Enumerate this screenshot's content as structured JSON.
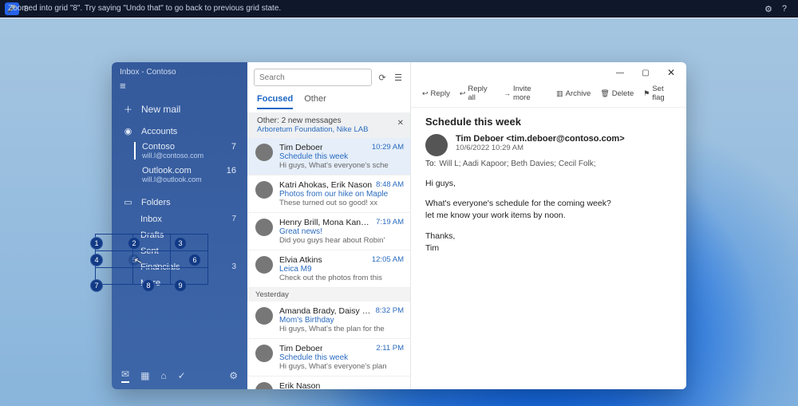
{
  "voicebar": {
    "indicator": "8",
    "message": "Zoomed into grid \"8\". Try saying \"Undo that\" to go back to previous grid state."
  },
  "sidebar": {
    "title": "Inbox - Contoso",
    "newmail": "New mail",
    "accounts_label": "Accounts",
    "accounts": [
      {
        "name": "Contoso",
        "email": "will.l@contoso.com",
        "count": "7"
      },
      {
        "name": "Outlook.com",
        "email": "will.l@outlook.com",
        "count": "16"
      }
    ],
    "folders_label": "Folders",
    "folders": [
      {
        "name": "Inbox",
        "count": "7"
      },
      {
        "name": "Drafts",
        "count": ""
      },
      {
        "name": "Sent",
        "count": ""
      },
      {
        "name": "Financials",
        "count": "3",
        "expandable": true
      },
      {
        "name": "More",
        "count": ""
      }
    ]
  },
  "list": {
    "search_placeholder": "Search",
    "tabs": {
      "focused": "Focused",
      "other": "Other"
    },
    "otherbar": {
      "line1": "Other: 2 new messages",
      "line2": "Arboretum Foundation, Nike LAB"
    },
    "items": [
      {
        "from": "Tim Deboer",
        "subject": "Schedule this week",
        "preview": "Hi guys, What's everyone's sche",
        "time": "10:29 AM",
        "selected": true
      },
      {
        "from": "Katri Ahokas, Erik Nason",
        "subject": "Photos from our hike on Maple",
        "preview": "These turned out so good! xx",
        "time": "8:48 AM"
      },
      {
        "from": "Henry Brill, Mona Kane, Cecil F",
        "subject": "Great news!",
        "preview": "Did you guys hear about Robin'",
        "time": "7:19 AM"
      },
      {
        "from": "Elvia Atkins",
        "subject": "Leica M9",
        "preview": "Check out the photos from this",
        "time": "12:05 AM"
      }
    ],
    "day": "Yesterday",
    "items2": [
      {
        "from": "Amanda Brady, Daisy Phillips",
        "subject": "Mom's Birthday",
        "preview": "Hi guys, What's the plan for the",
        "time": "8:32 PM"
      },
      {
        "from": "Tim Deboer",
        "subject": "Schedule this week",
        "preview": "Hi guys, What's everyone's plan",
        "time": "2:11 PM"
      },
      {
        "from": "Erik Nason",
        "subject": "",
        "preview": "",
        "time": ""
      }
    ]
  },
  "reading": {
    "actions": {
      "reply": "Reply",
      "replyall": "Reply all",
      "forward": "Invite more",
      "archive": "Archive",
      "delete": "Delete",
      "flag": "Set flag"
    },
    "subject": "Schedule this week",
    "sender": "Tim Deboer <tim.deboer@contoso.com>",
    "date": "10/6/2022 10:29 AM",
    "to_label": "To:",
    "to": "Will L; Aadi Kapoor; Beth Davies; Cecil Folk;",
    "body1": "Hi guys,",
    "body2": "What's everyone's schedule for the coming week?\nlet me know your work items by noon.",
    "body3": "Thanks,\nTim"
  },
  "grid_numbers": [
    "1",
    "2",
    "3",
    "4",
    "5",
    "6",
    "7",
    "8",
    "9"
  ]
}
